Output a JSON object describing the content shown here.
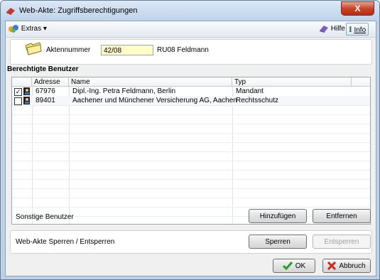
{
  "window": {
    "title": "Web-Akte: Zugriffsberechtigungen",
    "close_glyph": "X"
  },
  "toolbar": {
    "extras_label": "Extras",
    "extras_arrow": "▾",
    "help_label": "Hilfe",
    "info_label": "Info"
  },
  "akte": {
    "label": "Aktennummer",
    "value": "42/08",
    "description": "RU08 Feldmann"
  },
  "users": {
    "section_title": "Berechtigte Benutzer",
    "columns": [
      "Adresse",
      "Name",
      "Typ"
    ],
    "rows": [
      {
        "checked": true,
        "adresse": "67976",
        "name": "Dipl.-Ing. Petra Feldmann, Berlin",
        "typ": "Mandant"
      },
      {
        "checked": false,
        "adresse": "89401",
        "name": "Aachener und Münchener Versicherung AG, Aachen",
        "typ": "Rechtsschutz"
      }
    ],
    "check_glyph": "✓"
  },
  "other_users": {
    "label": "Sonstige Benutzer",
    "add_label": "Hinzufügen",
    "remove_label": "Entfernen"
  },
  "lock": {
    "label": "Web-Akte Sperren / Entsperren",
    "lock_label": "Sperren",
    "unlock_label": "Entsperren"
  },
  "footer": {
    "ok_label": "OK",
    "cancel_label": "Abbruch"
  },
  "colors": {
    "accent_red": "#c0392b",
    "input_yellow": "#fffdc8",
    "titlebar": "#bed3ea"
  }
}
